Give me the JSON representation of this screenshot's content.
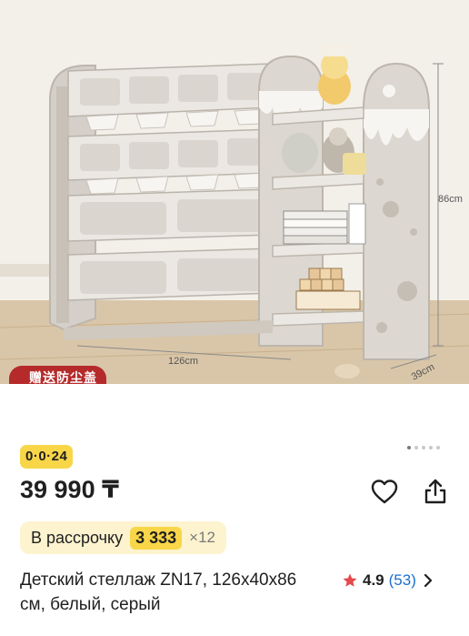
{
  "product_image": {
    "dimension_width": "126cm",
    "dimension_height": "86cm",
    "dimension_depth": "39cm",
    "promo_tag": "赠送防尘盖"
  },
  "gallery": {
    "total": 5,
    "active": 1
  },
  "badge": {
    "text": "0·0·24"
  },
  "price": {
    "text": "39 990 ₸"
  },
  "installment": {
    "label": "В рассрочку",
    "amount": "3 333",
    "months": "×12"
  },
  "product": {
    "title": "Детский стеллаж ZN17, 126x40x86 см, белый, серый"
  },
  "rating": {
    "value": "4.9",
    "count": "(53)"
  },
  "colors": {
    "accent_yellow": "#f8d648",
    "installment_bg": "#fdf3cf",
    "rating_star": "#e5484d",
    "review_link": "#1a6fd0"
  },
  "icons": {
    "favorite": "heart-icon",
    "share": "share-icon",
    "rating": "star-icon",
    "more": "chevron-right-icon"
  }
}
